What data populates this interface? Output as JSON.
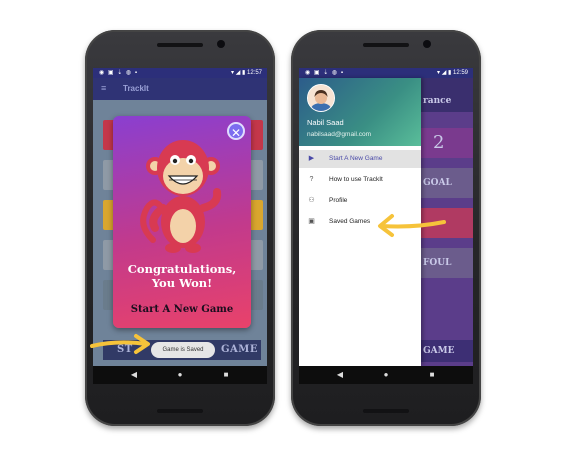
{
  "left_phone": {
    "status": {
      "left_icons": "◉ ▣ ⇣ ◍ ▪",
      "time": "12:57"
    },
    "app_title": "TrackIt",
    "dialog": {
      "heading_line1": "Congratulations,",
      "heading_line2": "You Won!",
      "start_label": "Start A New Game"
    },
    "toast": "Game is Saved",
    "bottom_button_left": "ST",
    "bottom_button_right": "GAME"
  },
  "right_phone": {
    "status": {
      "left_icons": "◉ ▣ ⇣ ◍ ▪",
      "time": "12:59"
    },
    "user": {
      "name": "Nabil Saad",
      "email": "nabilsaad@gmail.com"
    },
    "menu": [
      {
        "label": "Start A New Game",
        "icon": "play-icon",
        "active": true
      },
      {
        "label": "How to use TrackIt",
        "icon": "help-icon",
        "active": false
      },
      {
        "label": "Profile",
        "icon": "person-icon",
        "active": false
      },
      {
        "label": "Saved Games",
        "icon": "save-icon",
        "active": false
      }
    ],
    "background_fragments": {
      "top": "rance",
      "number": "2",
      "goal": "GOAL",
      "foul": "FOUL",
      "game": "GAME"
    }
  },
  "nav": {
    "back": "◀",
    "home": "●",
    "recents": "■"
  },
  "colors": {
    "accent_arrow": "#f6c33a",
    "status_bar": "#2c2f7a"
  }
}
